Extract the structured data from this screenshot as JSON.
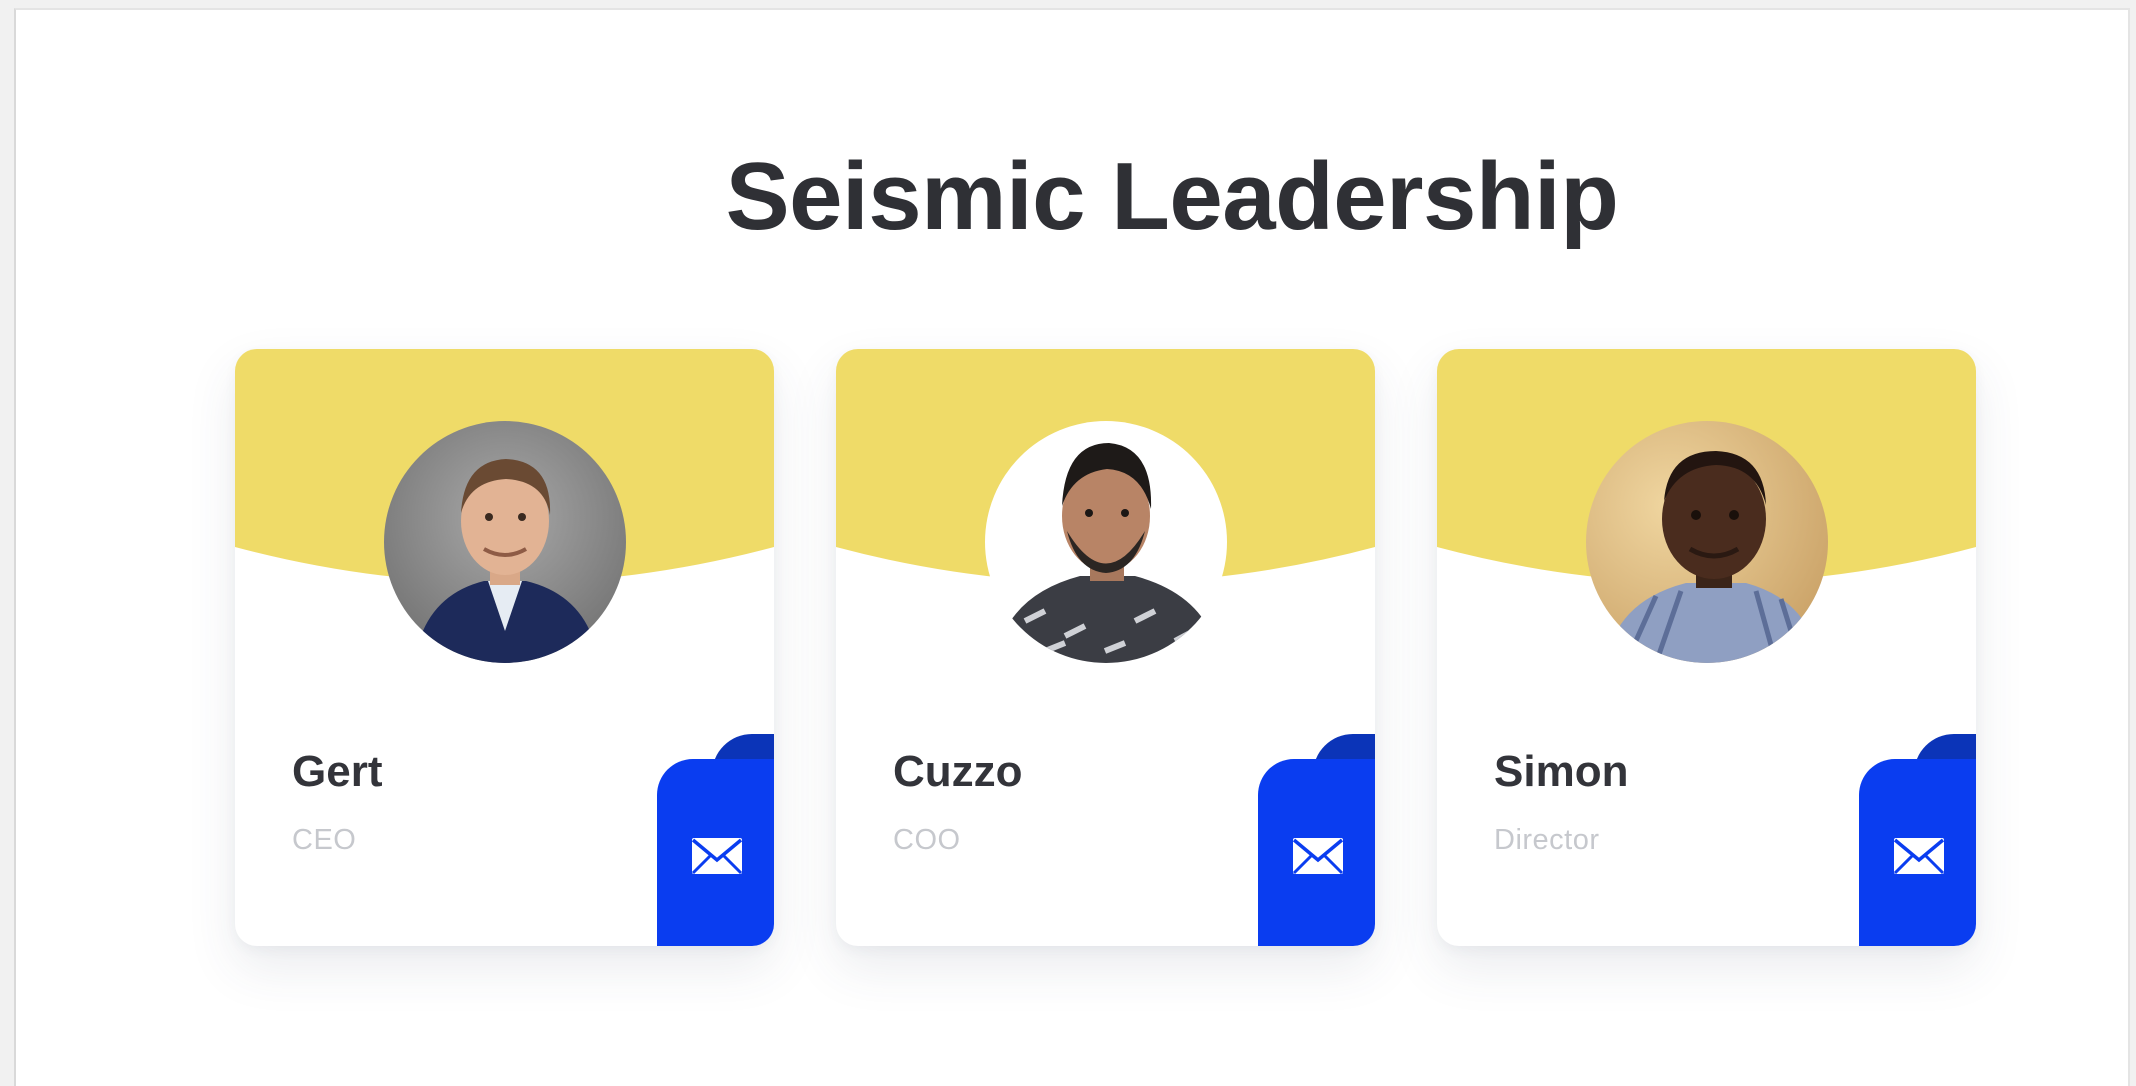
{
  "heading": "Seismic Leadership",
  "colors": {
    "banner": "#efdb68",
    "mail_button": "#0a3df0",
    "mail_button_shadow": "#0b34b8",
    "title": "#2f3035",
    "role_text": "#c6c8cd"
  },
  "members": [
    {
      "name": "Gert",
      "role": "CEO",
      "icon": "envelope-icon"
    },
    {
      "name": "Cuzzo",
      "role": "COO",
      "icon": "envelope-icon"
    },
    {
      "name": "Simon",
      "role": "Director",
      "icon": "envelope-icon"
    }
  ]
}
